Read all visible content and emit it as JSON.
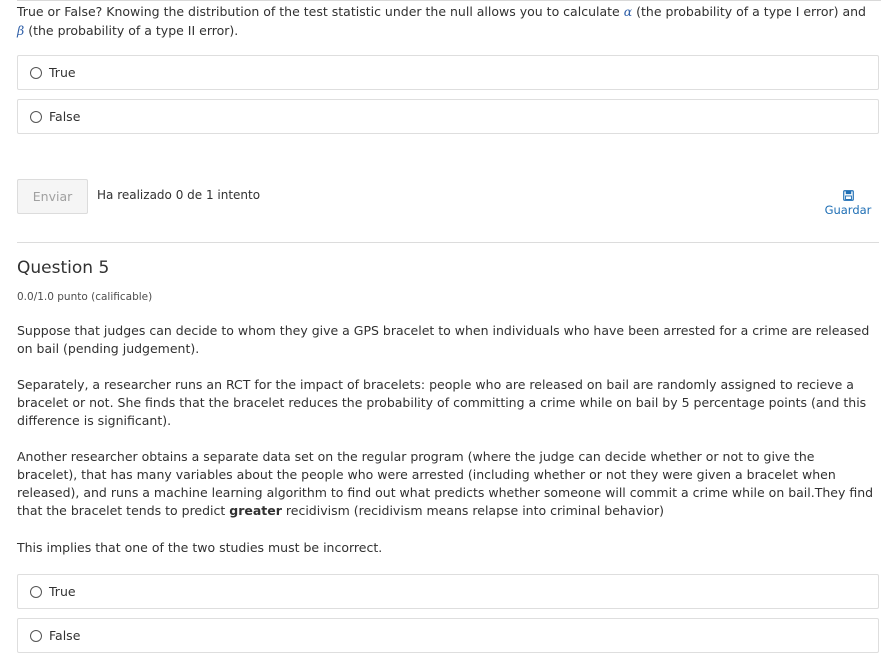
{
  "prev_question": {
    "prompt_part1": "True or False? Knowing the distribution of the test statistic under the null allows you to calculate ",
    "alpha_symbol": "α",
    "prompt_part2": " (the probability of a type I error) and ",
    "beta_symbol": "β",
    "prompt_part3": " (the probability of a type II error).",
    "options": [
      "True",
      "False"
    ]
  },
  "submit": {
    "button_label": "Enviar",
    "attempts_text": "Ha realizado 0 de 1 intento",
    "save_label": "Guardar"
  },
  "question": {
    "title": "Question 5",
    "points": "0.0/1.0 punto (calificable)",
    "para1": "Suppose that judges can decide to whom they give a GPS bracelet to when individuals who have been arrested for a crime are released on bail (pending judgement).",
    "para2": "Separately, a researcher runs an RCT for the impact of bracelets: people who are released on bail are randomly assigned to recieve a bracelet or not. She finds that the bracelet reduces the probability of committing a crime while on bail by 5 percentage points (and this difference is significant).",
    "para3_part1": "Another researcher obtains a separate data set on the regular program (where the judge can decide whether or not to give the bracelet), that has many variables about the people who were arrested (including whether or not they were given a bracelet when released), and runs a machine learning algorithm to find out what predicts whether someone will commit a crime while on bail.They find that the bracelet tends to predict ",
    "para3_bold": "greater",
    "para3_part2": " recidivism (recidivism means relapse into criminal behavior)",
    "para4": "This implies that one of the two studies must be incorrect.",
    "options": [
      "True",
      "False"
    ]
  }
}
